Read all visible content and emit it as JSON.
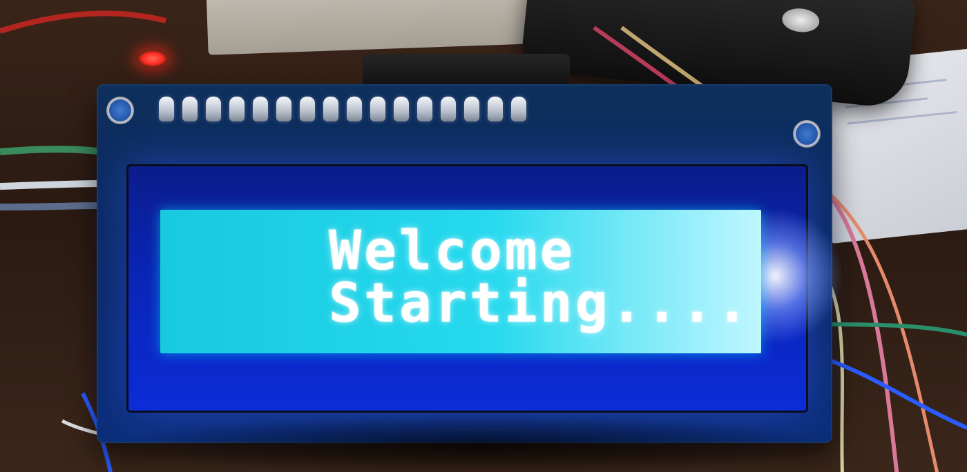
{
  "lcd": {
    "line1": "Welcome",
    "line2": "Starting...."
  },
  "colors": {
    "backlight": "#26d9ee",
    "bezel": "#0b2cd8",
    "text": "#ffffff",
    "led": "#ff2a1e"
  },
  "icons": {
    "power_led": "red-led-icon"
  }
}
